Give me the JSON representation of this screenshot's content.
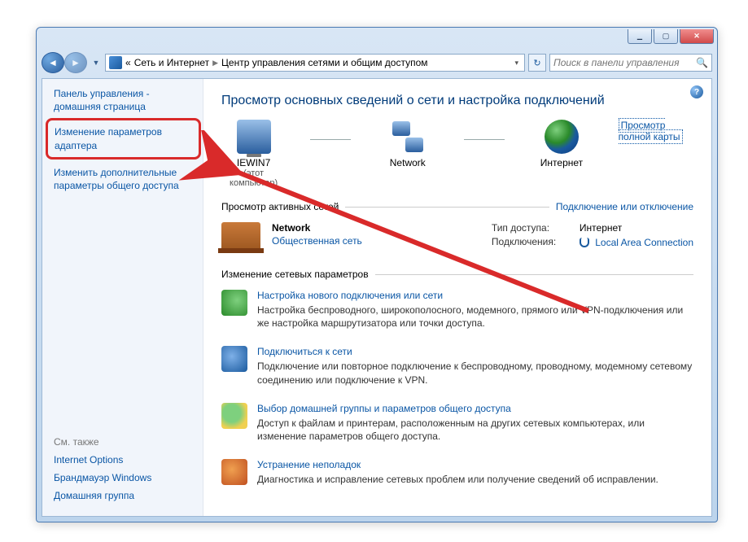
{
  "breadcrumb": {
    "prefix": "«",
    "level1": "Сеть и Интернет",
    "level2": "Центр управления сетями и общим доступом"
  },
  "search": {
    "placeholder": "Поиск в панели управления"
  },
  "sidebar": {
    "home": "Панель управления - домашняя страница",
    "adapter": "Изменение параметров адаптера",
    "sharing": "Изменить дополнительные параметры общего доступа",
    "see_also_title": "См. также",
    "see_also": {
      "internet_options": "Internet Options",
      "firewall": "Брандмауэр Windows",
      "homegroup": "Домашняя группа"
    }
  },
  "main": {
    "heading": "Просмотр основных сведений о сети и настройка подключений",
    "full_map": "Просмотр полной карты",
    "map": {
      "this_pc": "IEWIN7",
      "this_pc_sub": "(этот компьютер)",
      "network": "Network",
      "internet": "Интернет"
    },
    "active_title": "Просмотр активных сетей",
    "active_link": "Подключение или отключение",
    "network": {
      "name": "Network",
      "category": "Общественная сеть",
      "access_label": "Тип доступа:",
      "access_value": "Интернет",
      "conn_label": "Подключения:",
      "conn_value": "Local Area Connection"
    },
    "change_title": "Изменение сетевых параметров",
    "tasks": [
      {
        "title": "Настройка нового подключения или сети",
        "desc": "Настройка беспроводного, широкополосного, модемного, прямого или VPN-подключения или же настройка маршрутизатора или точки доступа."
      },
      {
        "title": "Подключиться к сети",
        "desc": "Подключение или повторное подключение к беспроводному, проводному, модемному сетевому соединению или подключение к VPN."
      },
      {
        "title": "Выбор домашней группы и параметров общего доступа",
        "desc": "Доступ к файлам и принтерам, расположенным на других сетевых компьютерах, или изменение параметров общего доступа."
      },
      {
        "title": "Устранение неполадок",
        "desc": "Диагностика и исправление сетевых проблем или получение сведений об исправлении."
      }
    ]
  }
}
